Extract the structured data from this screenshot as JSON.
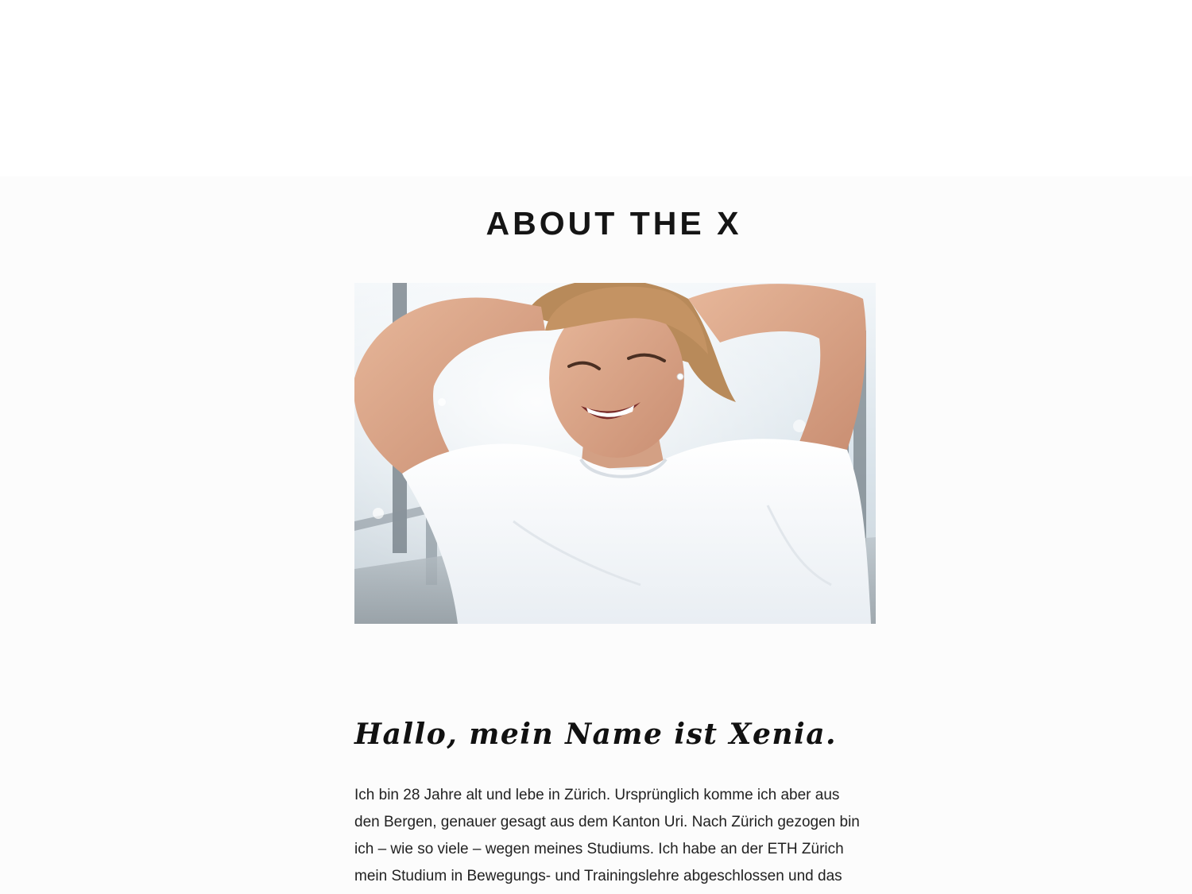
{
  "section": {
    "title": "ABOUT THE X"
  },
  "photo": {
    "alt": "Smiling woman in white t-shirt tying her hair on a sunny lakeside pier"
  },
  "greeting": "Hallo, mein Name ist Xenia.",
  "bio_lines": [
    "Ich bin 28 Jahre alt und lebe in Zürich. Ursprünglich komme ich aber aus",
    "den Bergen, genauer gesagt aus dem Kanton Uri. Nach Zürich gezogen bin",
    "ich – wie so viele – wegen meines Studiums. Ich habe an der ETH Zürich",
    "mein Studium in Bewegungs- und Trainingslehre abgeschlossen und das"
  ],
  "colors": {
    "page_background": "#fcfcfc",
    "top_band": "#ffffff",
    "text": "#1a1a1a"
  }
}
